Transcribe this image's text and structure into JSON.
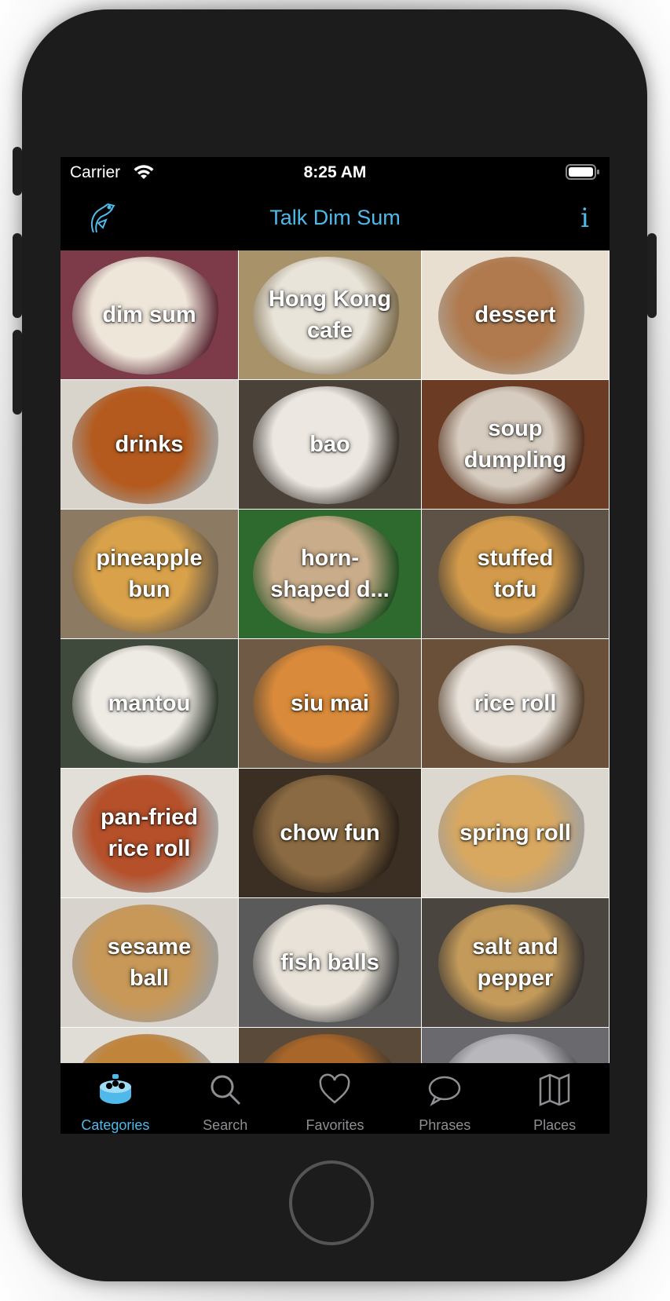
{
  "status_bar": {
    "carrier": "Carrier",
    "time": "8:25 AM"
  },
  "nav": {
    "title": "Talk Dim Sum",
    "info_label": "i",
    "logo_icon": "dragon-logo-icon",
    "accent_color": "#4fb9ea"
  },
  "categories": [
    {
      "label": "dim sum",
      "bg": "#7d3b4a",
      "plate": "#efe6da"
    },
    {
      "label": "Hong Kong\ncafe",
      "bg": "#a8926a",
      "plate": "#e9e4da"
    },
    {
      "label": "dessert",
      "bg": "#e9dfd0",
      "plate": "#b07a4e"
    },
    {
      "label": "drinks",
      "bg": "#d8d4cc",
      "plate": "#b45a1e"
    },
    {
      "label": "bao",
      "bg": "#4a4138",
      "plate": "#ece8e1"
    },
    {
      "label": "soup\ndumpling",
      "bg": "#6b3b23",
      "plate": "#d6ccbf"
    },
    {
      "label": "pineapple\nbun",
      "bg": "#8c7a62",
      "plate": "#d9a24a"
    },
    {
      "label": "horn-\nshaped d...",
      "bg": "#2e6a2e",
      "plate": "#c9ad8a"
    },
    {
      "label": "stuffed\ntofu",
      "bg": "#5d5245",
      "plate": "#d29a4a"
    },
    {
      "label": "mantou",
      "bg": "#3f4a3c",
      "plate": "#eeeae4"
    },
    {
      "label": "siu mai",
      "bg": "#6e5a45",
      "plate": "#d98a3a"
    },
    {
      "label": "rice roll",
      "bg": "#6a5038",
      "plate": "#e8e2da"
    },
    {
      "label": "pan-fried\nrice roll",
      "bg": "#e2ded8",
      "plate": "#b5502a"
    },
    {
      "label": "chow fun",
      "bg": "#3b2e22",
      "plate": "#8a6a42"
    },
    {
      "label": "spring roll",
      "bg": "#dcd7cf",
      "plate": "#d8a860"
    },
    {
      "label": "sesame\nball",
      "bg": "#d8d3cc",
      "plate": "#c89858"
    },
    {
      "label": "fish balls",
      "bg": "#5a5a5a",
      "plate": "#e8e2d8"
    },
    {
      "label": "salt and\npepper",
      "bg": "#4b4540",
      "plate": "#c39a5a"
    },
    {
      "label": "",
      "bg": "#e0dcd6",
      "plate": "#c0843a"
    },
    {
      "label": "",
      "bg": "#5a4a3a",
      "plate": "#a8662a"
    },
    {
      "label": "",
      "bg": "#6a6a6e",
      "plate": "#b8b8bc"
    }
  ],
  "tab_bar": {
    "tabs": [
      {
        "label": "Categories",
        "icon": "dim-sum-basket-icon"
      },
      {
        "label": "Search",
        "icon": "search-icon"
      },
      {
        "label": "Favorites",
        "icon": "heart-icon"
      },
      {
        "label": "Phrases",
        "icon": "speech-bubble-icon"
      },
      {
        "label": "Places",
        "icon": "map-icon"
      }
    ],
    "active_index": 0
  }
}
